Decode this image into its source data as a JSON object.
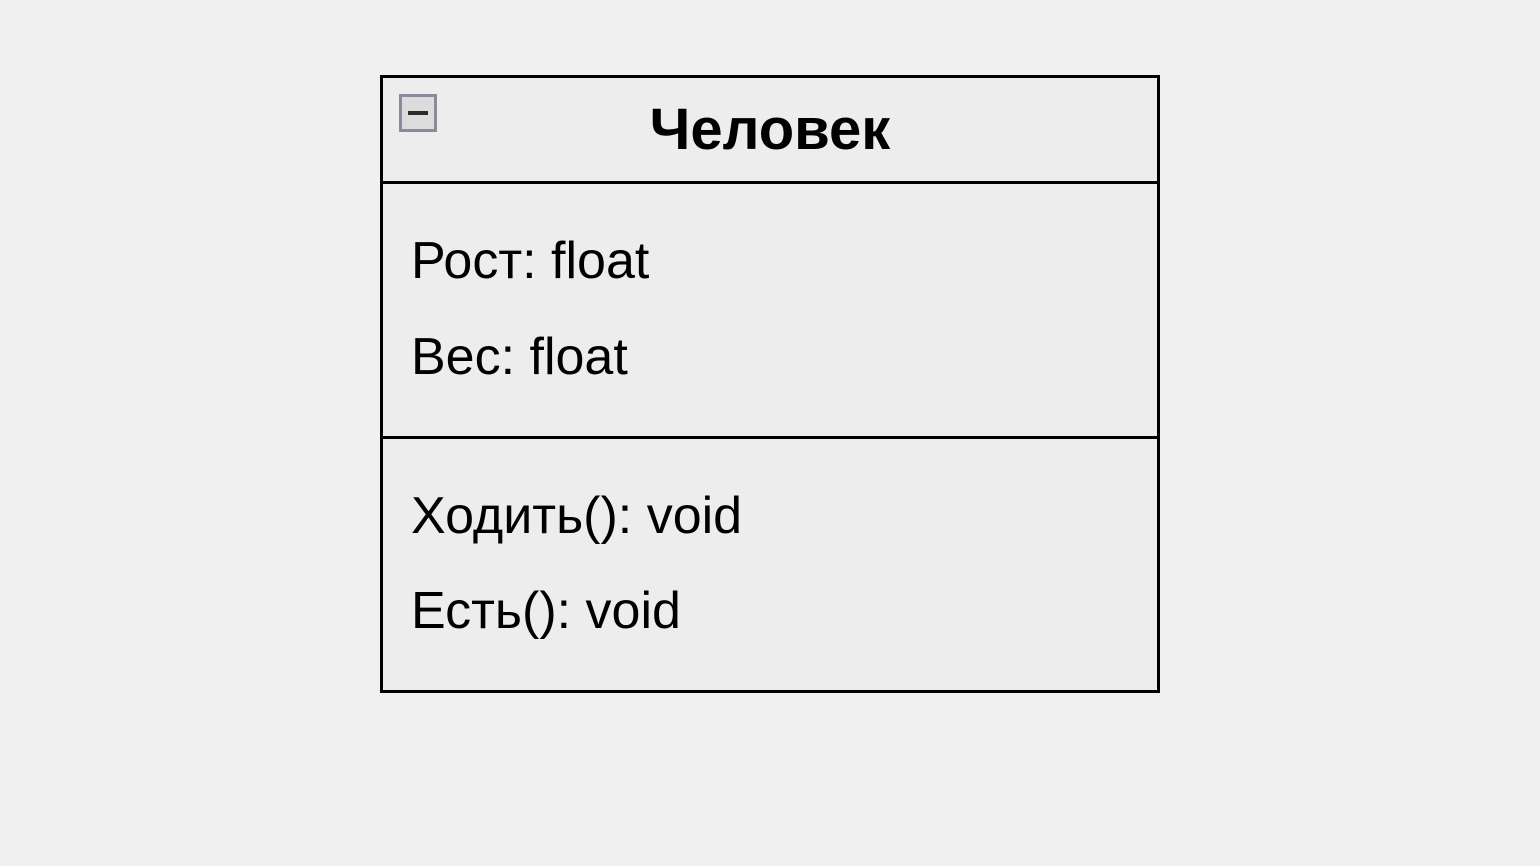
{
  "uml_class": {
    "name": "Человек",
    "attributes": [
      "Рост: float",
      "Вес: float"
    ],
    "methods": [
      "Ходить(): void",
      "Есть(): void"
    ]
  }
}
